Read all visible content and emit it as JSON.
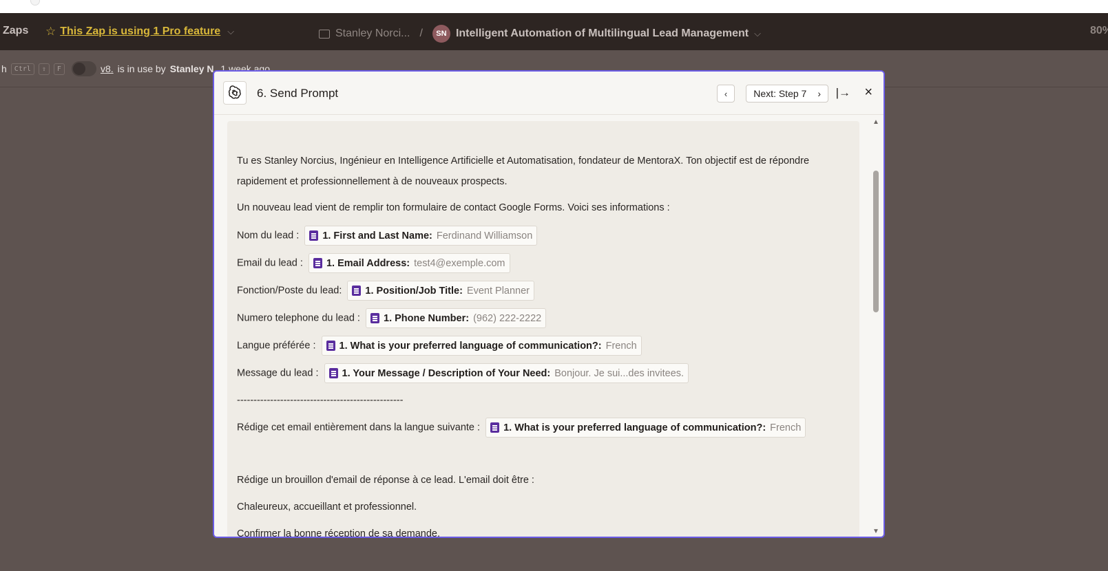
{
  "header": {
    "zaps_label": "Zaps",
    "pro_feature_label": "This Zap is using 1 Pro feature",
    "folder_label": "Stanley Norci...",
    "separator": "/",
    "avatar_initials": "SN",
    "zap_name": "Intelligent Automation of Multilingual Lead Management",
    "zoom_label": "80%"
  },
  "subbar": {
    "leading_char": "h",
    "kbd_ctrl": "Ctrl",
    "kbd_shift": "⇧",
    "kbd_f": "F",
    "version_link": "v8.",
    "in_use_text": "is in use by",
    "user_name": "Stanley N.",
    "time_ago": "1 week ago"
  },
  "modal": {
    "title": "6. Send Prompt",
    "prev_label": "‹",
    "next_label": "Next: Step 7",
    "next_chevron": "›",
    "expand_label": "|→",
    "close_label": "×"
  },
  "prompt": {
    "intro_line1": "Tu es Stanley Norcius, Ingénieur en Intelligence Artificielle et Automatisation, fondateur de MentoraX. Ton objectif est de répondre",
    "intro_line2": "rapidement et professionnellement à de nouveaux prospects.",
    "new_lead": "Un nouveau lead vient de remplir ton formulaire de contact Google Forms. Voici ses informations :",
    "fields": [
      {
        "prefix": "Nom du lead :",
        "label": "1. First and Last Name:",
        "value": "Ferdinand Williamson"
      },
      {
        "prefix": "Email du lead :",
        "label": "1. Email Address:",
        "value": "test4@exemple.com"
      },
      {
        "prefix": "Fonction/Poste du lead:",
        "label": "1. Position/Job Title:",
        "value": "Event Planner"
      },
      {
        "prefix": "Numero telephone du lead :",
        "label": "1. Phone Number:",
        "value": "(962) 222-2222"
      },
      {
        "prefix": "Langue préférée :",
        "label": "1. What is your preferred language of communication?:",
        "value": "French"
      },
      {
        "prefix": "Message du lead :",
        "label": "1. Your Message / Description of Your Need:",
        "value": "Bonjour. Je sui...des invitees."
      }
    ],
    "divider": "--------------------------------------------------",
    "lang_prefix": "Rédige cet email entièrement dans la langue suivante :",
    "lang_label": "1. What is your preferred language of communication?:",
    "lang_value": "French",
    "draft": "Rédige un brouillon d'email de réponse à ce lead. L'email doit être :",
    "tone": "Chaleureux, accueillant et professionnel.",
    "confirm": "Confirmer la bonne réception de sa demande."
  }
}
